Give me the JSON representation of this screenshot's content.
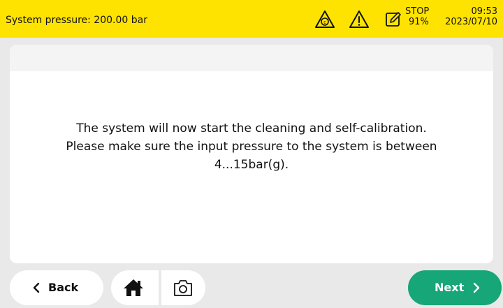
{
  "status_bar": {
    "pressure_text": "System pressure: 200.00 bar",
    "stop_label": "STOP",
    "stop_percent": "91%",
    "time": "09:53",
    "date": "2023/07/10",
    "icons": [
      "calibration-warning-icon",
      "warning-icon",
      "edit-icon"
    ],
    "background_color": "#ffe300"
  },
  "dialog": {
    "message_lines": [
      "The system will now start the cleaning and self-calibration.",
      "Please make sure the input pressure to the system is between",
      "4...15bar(g)."
    ]
  },
  "footer": {
    "back_label": "Back",
    "next_label": "Next",
    "next_color": "#16a677",
    "icons": [
      "home-icon",
      "camera-icon"
    ]
  }
}
